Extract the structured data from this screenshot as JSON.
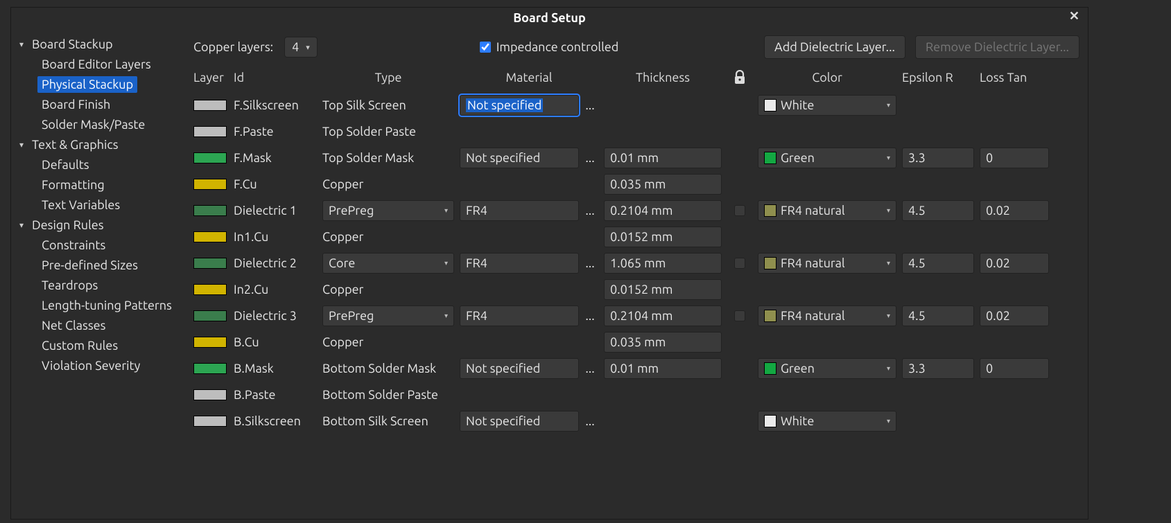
{
  "title": "Board Setup",
  "sidebar": {
    "groups": [
      {
        "label": "Board Stackup",
        "items": [
          "Board Editor Layers",
          "Physical Stackup",
          "Board Finish",
          "Solder Mask/Paste"
        ],
        "selected": 1
      },
      {
        "label": "Text & Graphics",
        "items": [
          "Defaults",
          "Formatting",
          "Text Variables"
        ],
        "selected": -1
      },
      {
        "label": "Design Rules",
        "items": [
          "Constraints",
          "Pre-defined Sizes",
          "Teardrops",
          "Length-tuning Patterns",
          "Net Classes",
          "Custom Rules",
          "Violation Severity"
        ],
        "selected": -1
      }
    ]
  },
  "top": {
    "copper_label": "Copper layers:",
    "copper_value": "4",
    "impedance_label": "Impedance controlled",
    "impedance_checked": true,
    "add_btn": "Add Dielectric Layer...",
    "remove_btn": "Remove Dielectric Layer..."
  },
  "headers": {
    "layer": "Layer",
    "id": "Id",
    "type": "Type",
    "material": "Material",
    "thickness": "Thickness",
    "color": "Color",
    "epsilon": "Epsilon R",
    "loss": "Loss Tan"
  },
  "swatch_colors": {
    "silk": "#bdbdbd",
    "paste": "#bdbdbd",
    "mask": "#2ca552",
    "mask_dim": "#3a7d4c",
    "copper": "#d1b400",
    "dielectric": "#3a7d4c"
  },
  "dd_colors": {
    "white": "#eaeaea",
    "green": "#13a842",
    "fr4": "#8f8f4e"
  },
  "rows": [
    {
      "swatch": "silk",
      "id": "F.Silkscreen",
      "type": "Top Silk Screen",
      "material": "Not specified",
      "mat_sel": true,
      "type_dd": false,
      "thickness": "",
      "lock": null,
      "color": "White",
      "color_sw": "white",
      "eps": "",
      "loss": ""
    },
    {
      "swatch": "paste",
      "id": "F.Paste",
      "type": "Top Solder Paste",
      "material": "",
      "type_dd": false,
      "thickness": "",
      "lock": null,
      "color": "",
      "color_sw": "",
      "eps": "",
      "loss": ""
    },
    {
      "swatch": "mask",
      "id": "F.Mask",
      "type": "Top Solder Mask",
      "material": "Not specified",
      "type_dd": false,
      "thickness": "0.01 mm",
      "lock": null,
      "color": "Green",
      "color_sw": "green",
      "eps": "3.3",
      "loss": "0"
    },
    {
      "swatch": "copper",
      "id": "F.Cu",
      "type": "Copper",
      "material": "",
      "type_dd": false,
      "thickness": "0.035 mm",
      "lock": null,
      "color": "",
      "color_sw": "",
      "eps": "",
      "loss": ""
    },
    {
      "swatch": "dielectric",
      "id": "Dielectric 1",
      "type": "PrePreg",
      "type_dd": true,
      "material": "FR4",
      "thickness": "0.2104 mm",
      "lock": "box",
      "color": "FR4 natural",
      "color_sw": "fr4",
      "eps": "4.5",
      "loss": "0.02"
    },
    {
      "swatch": "copper",
      "id": "In1.Cu",
      "type": "Copper",
      "material": "",
      "type_dd": false,
      "thickness": "0.0152 mm",
      "lock": null,
      "color": "",
      "color_sw": "",
      "eps": "",
      "loss": ""
    },
    {
      "swatch": "dielectric",
      "id": "Dielectric 2",
      "type": "Core",
      "type_dd": true,
      "material": "FR4",
      "thickness": "1.065 mm",
      "lock": "box",
      "color": "FR4 natural",
      "color_sw": "fr4",
      "eps": "4.5",
      "loss": "0.02"
    },
    {
      "swatch": "copper",
      "id": "In2.Cu",
      "type": "Copper",
      "material": "",
      "type_dd": false,
      "thickness": "0.0152 mm",
      "lock": null,
      "color": "",
      "color_sw": "",
      "eps": "",
      "loss": ""
    },
    {
      "swatch": "dielectric",
      "id": "Dielectric 3",
      "type": "PrePreg",
      "type_dd": true,
      "material": "FR4",
      "thickness": "0.2104 mm",
      "lock": "box",
      "color": "FR4 natural",
      "color_sw": "fr4",
      "eps": "4.5",
      "loss": "0.02"
    },
    {
      "swatch": "copper",
      "id": "B.Cu",
      "type": "Copper",
      "material": "",
      "type_dd": false,
      "thickness": "0.035 mm",
      "lock": null,
      "color": "",
      "color_sw": "",
      "eps": "",
      "loss": ""
    },
    {
      "swatch": "mask",
      "id": "B.Mask",
      "type": "Bottom Solder Mask",
      "material": "Not specified",
      "type_dd": false,
      "thickness": "0.01 mm",
      "lock": null,
      "color": "Green",
      "color_sw": "green",
      "eps": "3.3",
      "loss": "0"
    },
    {
      "swatch": "paste",
      "id": "B.Paste",
      "type": "Bottom Solder Paste",
      "material": "",
      "type_dd": false,
      "thickness": "",
      "lock": null,
      "color": "",
      "color_sw": "",
      "eps": "",
      "loss": ""
    },
    {
      "swatch": "silk",
      "id": "B.Silkscreen",
      "type": "Bottom Silk Screen",
      "material": "Not specified",
      "type_dd": false,
      "thickness": "",
      "lock": null,
      "color": "White",
      "color_sw": "white",
      "eps": "",
      "loss": ""
    }
  ]
}
